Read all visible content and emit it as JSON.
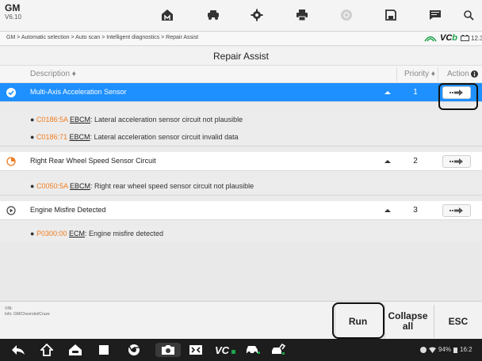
{
  "app": {
    "name": "GM",
    "version": "V6.10"
  },
  "breadcrumb": "GM > Automatic selection > Auto scan > Intelligent diagnostics > Repair Assist",
  "vci": {
    "label_v": "V",
    "label_c": "C",
    "label_b": "b",
    "battery_text": "12.3"
  },
  "title": "Repair Assist",
  "columns": {
    "description": "Description ♦",
    "priority": "Priority ♦",
    "action": "Action"
  },
  "rows": [
    {
      "label": "Multi-Axis Acceleration Sensor",
      "priority": "1",
      "selected": true,
      "dtcs": [
        {
          "code": "C0186:5A",
          "module": "EBCM",
          "text": ": Lateral acceleration sensor circuit not plausible"
        },
        {
          "code": "C0186:71",
          "module": "EBCM",
          "text": ": Lateral acceleration sensor circuit invalid data"
        }
      ]
    },
    {
      "label": "Right Rear Wheel Speed Sensor Circuit",
      "priority": "2",
      "selected": false,
      "dtcs": [
        {
          "code": "C0050:5A",
          "module": "EBCM",
          "text": ": Right rear wheel speed sensor circuit not plausible"
        }
      ]
    },
    {
      "label": "Engine Misfire Detected",
      "priority": "3",
      "selected": false,
      "dtcs": [
        {
          "code": "P0300:00",
          "module": "ECM",
          "text": ": Engine misfire detected"
        }
      ]
    }
  ],
  "vehicle_info": {
    "vin": "VIN:",
    "info": "Info: GM/Chevrolet/Cruze"
  },
  "buttons": {
    "run": "Run",
    "collapse_all": "Collapse all",
    "esc": "ESC"
  },
  "status_bar": {
    "battery": "94%",
    "time": "16:2"
  },
  "icons": {
    "toolbar": [
      "home-icon",
      "vehicle-menu-icon",
      "settings-icon",
      "print-icon",
      "help-icon",
      "save-icon",
      "message-icon",
      "search-icon"
    ],
    "rows": [
      "check-circle-icon",
      "timer-icon",
      "play-circle-icon"
    ],
    "nav": [
      "back-icon",
      "home-icon",
      "vehicle-home-icon",
      "recent-apps-icon",
      "browser-icon",
      "camera-icon",
      "screenshot-icon",
      "vci-icon",
      "car-icon",
      "repair-icon"
    ]
  },
  "colors": {
    "selected_row": "#1e90ff",
    "dtc_code": "#f07c1e",
    "vci_green": "#1ba34a"
  }
}
